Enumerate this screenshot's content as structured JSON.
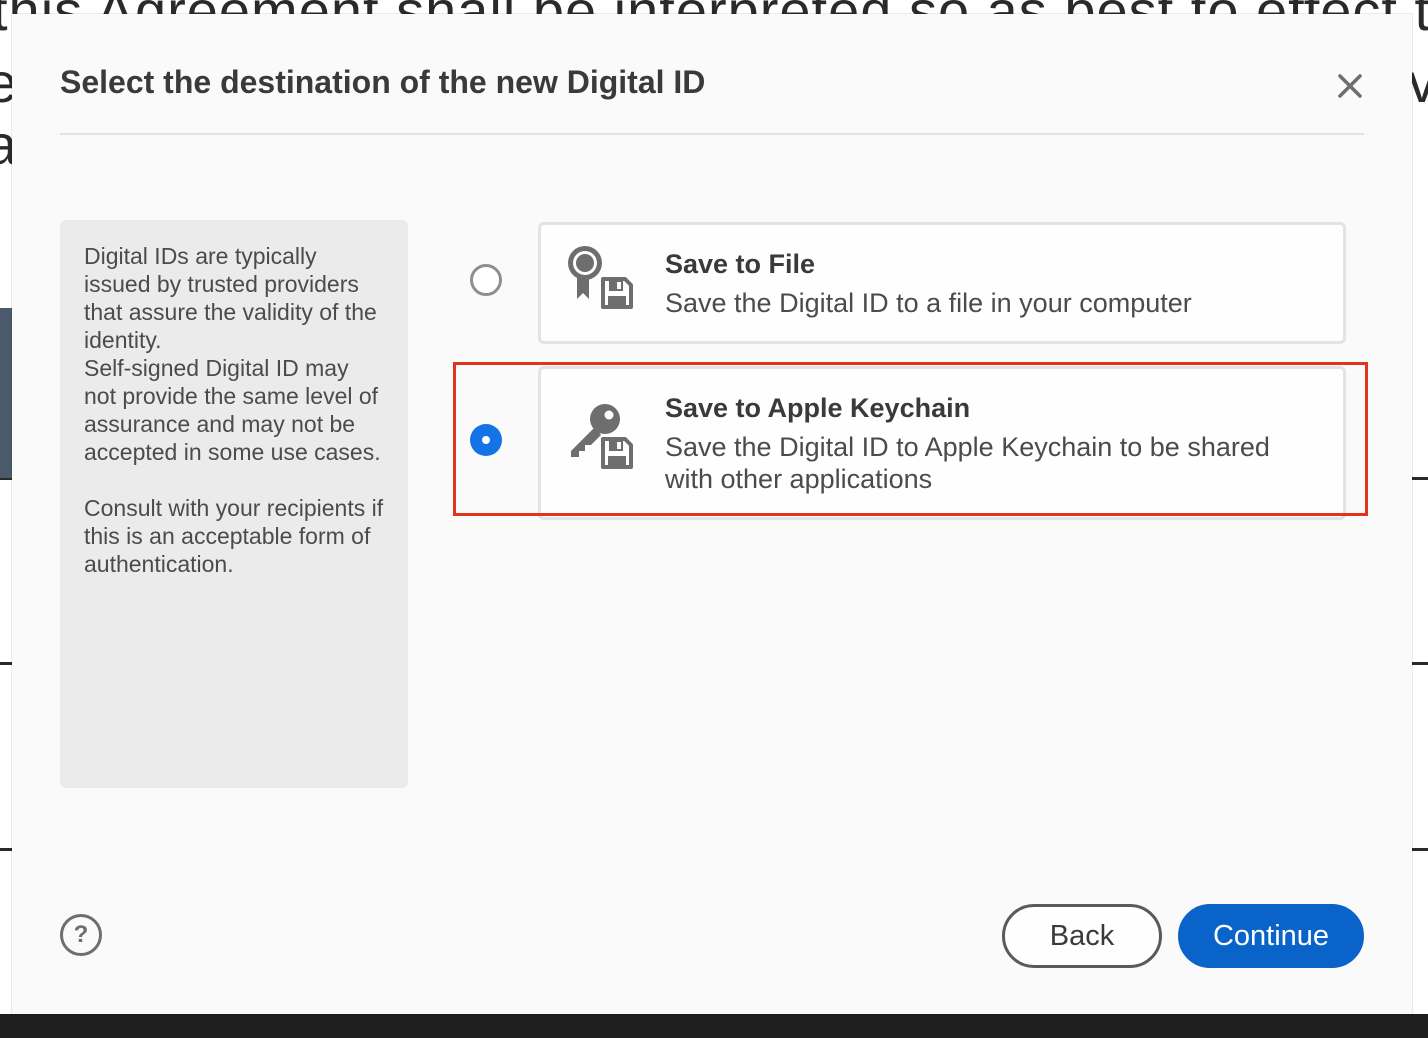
{
  "background": {
    "doc_text_line1": "this Agreement shall be interpreted so as best to effect the i",
    "doc_frag_e": "e",
    "doc_frag_a": "a",
    "doc_frag_v": "v"
  },
  "dialog": {
    "title": "Select the destination of the new Digital ID",
    "close_icon": "close-icon",
    "info": {
      "paragraph1": "Digital IDs are typically issued by trusted providers that assure the validity of the identity.",
      "paragraph2": "Self-signed Digital ID may not provide the same level of assurance and may not be accepted in some use cases.",
      "paragraph3": "Consult with your recipients if this is an acceptable form of authentication."
    },
    "options": [
      {
        "title": "Save to File",
        "description": "Save the Digital ID to a file in your computer",
        "selected": false,
        "icon": "certificate-file-icon"
      },
      {
        "title": "Save to Apple Keychain",
        "description": "Save the Digital ID to Apple Keychain to be shared with other applications",
        "selected": true,
        "icon": "key-file-icon"
      }
    ],
    "help_label": "?",
    "back_label": "Back",
    "continue_label": "Continue"
  },
  "colors": {
    "accent": "#0a63c9",
    "radio_selected": "#1473e6",
    "highlight": "#e0341c"
  }
}
